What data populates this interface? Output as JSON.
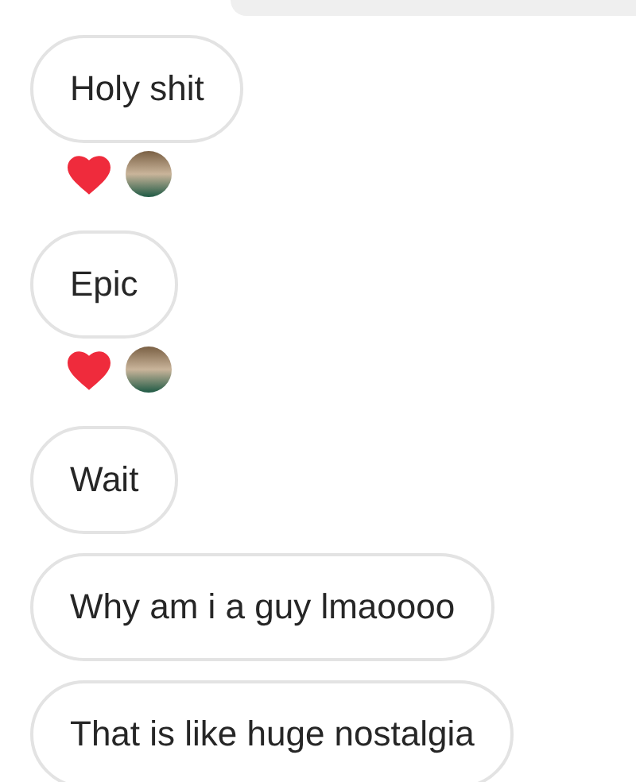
{
  "messages": [
    {
      "text": "Holy shit",
      "reactions": [
        {
          "kind": "heart"
        },
        {
          "kind": "avatar"
        }
      ]
    },
    {
      "text": "Epic",
      "reactions": [
        {
          "kind": "heart"
        },
        {
          "kind": "avatar"
        }
      ]
    },
    {
      "text": "Wait"
    },
    {
      "text": "Why am i a guy lmaoooo"
    },
    {
      "text": "That is like huge nostalgia"
    }
  ]
}
